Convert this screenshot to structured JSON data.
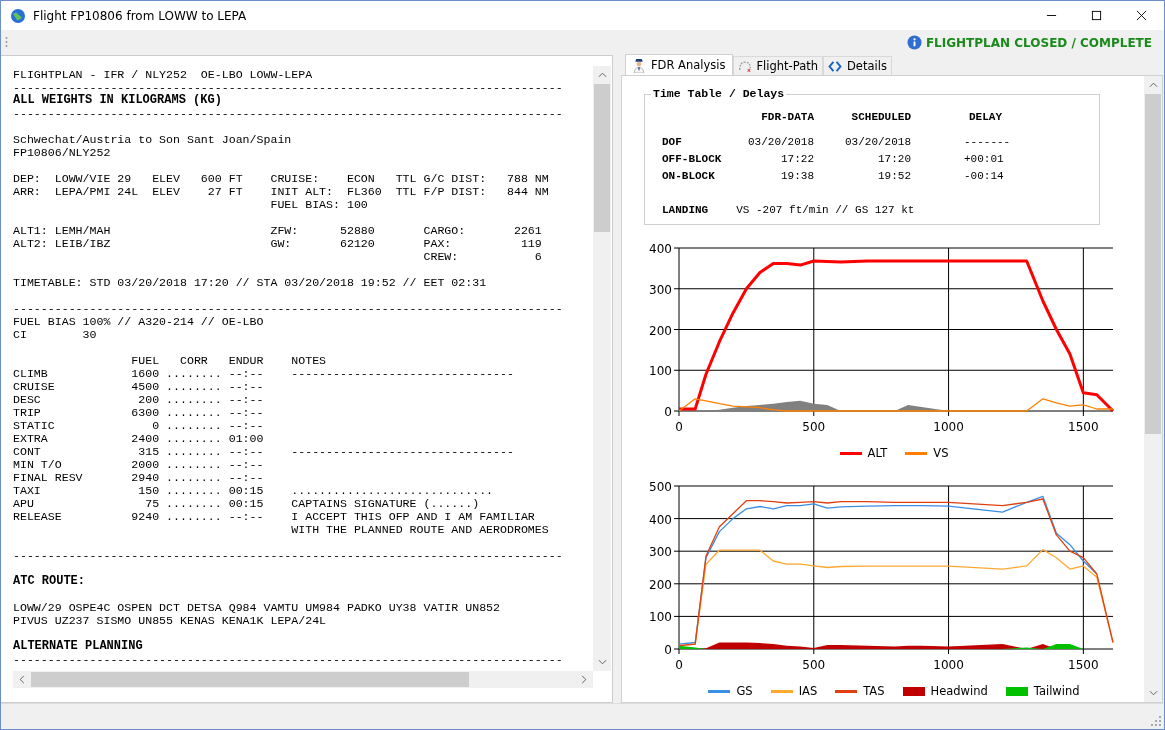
{
  "window": {
    "title": "Flight FP10806 from LOWW to LEPA"
  },
  "status": {
    "text": "FLIGHTPLAN CLOSED / COMPLETE"
  },
  "flightplan": {
    "blocks": [
      [
        {
          "text": "FLIGHTPLAN - IFR / NLY252  OE-LBO LOWW-LEPA",
          "bold": false
        },
        {
          "text": "-------------------------------------------------------------------------------",
          "bold": false
        },
        {
          "text": "ALL WEIGHTS IN KILOGRAMS (KG)",
          "bold": true
        },
        {
          "text": "-------------------------------------------------------------------------------",
          "bold": false
        }
      ],
      [
        {
          "text": "Schwechat/Austria to Son Sant Joan/Spain",
          "bold": false
        },
        {
          "text": "FP10806/NLY252",
          "bold": false
        }
      ],
      [
        {
          "text": "DEP:  LOWW/VIE 29   ELEV   600 FT    CRUISE:    ECON   TTL G/C DIST:   788 NM",
          "bold": false
        },
        {
          "text": "ARR:  LEPA/PMI 24L  ELEV    27 FT    INIT ALT:  FL360  TTL F/P DIST:   844 NM",
          "bold": false
        },
        {
          "text": "                                     FUEL BIAS: 100",
          "bold": false
        }
      ],
      [
        {
          "text": "ALT1: LEMH/MAH                       ZFW:      52880       CARGO:       2261",
          "bold": false
        },
        {
          "text": "ALT2: LEIB/IBZ                       GW:       62120       PAX:          119",
          "bold": false
        },
        {
          "text": "                                                           CREW:           6",
          "bold": false
        }
      ],
      [
        {
          "text": "TIMETABLE: STD 03/20/2018 17:20 // STA 03/20/2018 19:52 // EET 02:31",
          "bold": false
        }
      ],
      [
        {
          "text": "-------------------------------------------------------------------------------",
          "bold": false
        },
        {
          "text": "FUEL BIAS 100% // A320-214 // OE-LBO",
          "bold": false
        },
        {
          "text": "CI        30",
          "bold": false
        }
      ],
      [
        {
          "text": "                 FUEL   CORR   ENDUR    NOTES",
          "bold": false
        },
        {
          "text": "CLIMB            1600 ........ --:--    --------------------------------",
          "bold": false
        },
        {
          "text": "CRUISE           4500 ........ --:--",
          "bold": false
        },
        {
          "text": "DESC              200 ........ --:--",
          "bold": false
        },
        {
          "text": "TRIP             6300 ........ --:--",
          "bold": false
        },
        {
          "text": "STATIC              0 ........ --:--",
          "bold": false
        },
        {
          "text": "EXTRA            2400 ........ 01:00",
          "bold": false
        },
        {
          "text": "CONT              315 ........ --:--    --------------------------------",
          "bold": false
        },
        {
          "text": "MIN T/O          2000 ........ --:--",
          "bold": false
        },
        {
          "text": "FINAL RESV       2940 ........ --:--",
          "bold": false
        },
        {
          "text": "TAXI              150 ........ 00:15    .............................",
          "bold": false
        },
        {
          "text": "APU                75 ........ 00:15    CAPTAINS SIGNATURE (......)",
          "bold": false
        },
        {
          "text": "RELEASE          9240 ........ --:--    I ACCEPT THIS OFP AND I AM FAMILIAR",
          "bold": false
        },
        {
          "text": "                                        WITH THE PLANNED ROUTE AND AERODROMES",
          "bold": false
        }
      ],
      [
        {
          "text": "-------------------------------------------------------------------------------",
          "bold": false
        }
      ],
      [
        {
          "text": "ATC ROUTE:",
          "bold": true
        }
      ],
      [
        {
          "text": "LOWW/29 OSPE4C OSPEN DCT DETSA Q984 VAMTU UM984 PADKO UY38 VATIR UN852",
          "bold": false
        },
        {
          "text": "PIVUS UZ237 SISMO UN855 KENAS KENA1K LEPA/24L",
          "bold": false
        }
      ],
      [
        {
          "text": "ALTERNATE PLANNING",
          "bold": true
        },
        {
          "text": "-------------------------------------------------------------------------------",
          "bold": false
        }
      ]
    ]
  },
  "tabs": [
    {
      "label": "FDR Analysis",
      "selected": true,
      "kind": "pilot"
    },
    {
      "label": "Flight-Path",
      "selected": false,
      "kind": "path"
    },
    {
      "label": "Details",
      "selected": false,
      "kind": "code"
    }
  ],
  "time_table": {
    "title": "Time Table / Delays",
    "columns": [
      "FDR-DATA",
      "SCHEDULED",
      "DELAY"
    ],
    "rows": [
      {
        "label": "DOF",
        "cells": [
          "03/20/2018",
          "03/20/2018",
          "-------"
        ]
      },
      {
        "label": "OFF-BLOCK",
        "cells": [
          "17:22",
          "17:20",
          "+00:01"
        ]
      },
      {
        "label": "ON-BLOCK",
        "cells": [
          "19:38",
          "19:52",
          "-00:14"
        ]
      }
    ],
    "landing": {
      "label": "LANDING",
      "value": "VS -207 ft/min // GS 127 kt"
    }
  },
  "charts": [
    {
      "chart_data": {
        "type": "line",
        "x": [
          0,
          60,
          100,
          150,
          200,
          250,
          300,
          350,
          400,
          450,
          500,
          550,
          600,
          700,
          800,
          850,
          900,
          1000,
          1200,
          1290,
          1350,
          1400,
          1450,
          1500,
          1550,
          1610
        ],
        "xlim": [
          0,
          1610
        ],
        "ylim": [
          0,
          400
        ],
        "grid": true,
        "legend": "bottom",
        "xticks": [
          0,
          500,
          1000,
          1500
        ],
        "yticks": [
          0,
          100,
          200,
          300,
          400
        ],
        "series": [
          {
            "name": "ALT",
            "color": "#ff0000",
            "type": "line",
            "values": [
              5,
              5,
              90,
              170,
              240,
              300,
              340,
              362,
              362,
              358,
              368,
              367,
              366,
              368,
              368,
              368,
              368,
              368,
              368,
              368,
              270,
              200,
              140,
              45,
              40,
              0
            ]
          },
          {
            "name": "VS",
            "color": "#ff8000",
            "type": "line",
            "values": [
              0,
              30,
              25,
              18,
              12,
              10,
              8,
              3,
              0,
              0,
              0,
              0,
              0,
              0,
              0,
              0,
              0,
              0,
              0,
              0,
              30,
              20,
              12,
              15,
              5,
              5
            ]
          },
          {
            "color": "#808080",
            "type": "area",
            "values": [
              0,
              0,
              0,
              3,
              8,
              12,
              15,
              18,
              22,
              25,
              18,
              15,
              0,
              0,
              0,
              15,
              10,
              0,
              0,
              0,
              0,
              0,
              0,
              0,
              0,
              0
            ]
          }
        ]
      }
    },
    {
      "chart_data": {
        "type": "line",
        "x": [
          0,
          60,
          100,
          150,
          200,
          250,
          300,
          350,
          400,
          450,
          500,
          550,
          600,
          700,
          800,
          850,
          900,
          1000,
          1200,
          1290,
          1350,
          1400,
          1450,
          1500,
          1550,
          1610
        ],
        "xlim": [
          0,
          1610
        ],
        "ylim": [
          0,
          500
        ],
        "grid": true,
        "legend": "bottom",
        "xticks": [
          0,
          500,
          1000,
          1500
        ],
        "yticks": [
          0,
          100,
          200,
          300,
          400,
          500
        ],
        "series": [
          {
            "name": "GS",
            "color": "#3a8ee6",
            "type": "line",
            "values": [
              15,
              20,
              280,
              360,
              400,
              430,
              437,
              430,
              440,
              440,
              445,
              432,
              436,
              438,
              440,
              440,
              440,
              438,
              420,
              450,
              468,
              355,
              320,
              270,
              230,
              null
            ]
          },
          {
            "name": "IAS",
            "color": "#ffa830",
            "type": "line",
            "values": [
              10,
              15,
              260,
              303,
              303,
              303,
              303,
              270,
              260,
              260,
              255,
              250,
              253,
              254,
              254,
              254,
              254,
              254,
              245,
              255,
              305,
              280,
              245,
              255,
              220,
              20
            ]
          },
          {
            "name": "TAS",
            "color": "#e04010",
            "type": "line",
            "values": [
              10,
              15,
              285,
              375,
              415,
              455,
              455,
              452,
              448,
              450,
              452,
              448,
              452,
              452,
              450,
              450,
              450,
              450,
              440,
              450,
              460,
              350,
              300,
              280,
              230,
              20
            ]
          },
          {
            "name": "Headwind",
            "color": "#c00000",
            "type": "area",
            "values": [
              0,
              0,
              2,
              20,
              20,
              20,
              18,
              15,
              10,
              8,
              3,
              12,
              12,
              10,
              8,
              10,
              10,
              8,
              15,
              0,
              15,
              0,
              0,
              0,
              0,
              0
            ]
          },
          {
            "name": "Tailwind",
            "color": "#00c000",
            "type": "area",
            "values": [
              10,
              5,
              0,
              0,
              0,
              0,
              0,
              0,
              0,
              0,
              0,
              0,
              0,
              0,
              0,
              0,
              0,
              0,
              0,
              5,
              0,
              15,
              15,
              0,
              0,
              0
            ]
          }
        ]
      }
    }
  ]
}
